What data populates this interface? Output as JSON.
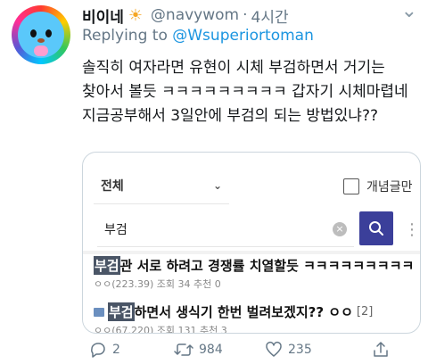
{
  "tweet": {
    "display_name": "비이네",
    "handle": "@navywom",
    "separator": "·",
    "time": "4시간",
    "reply_prefix": "Replying to",
    "reply_to": "@Wsuperiortoman",
    "text": "솔직히 여자라면 유현이 시체 부검하면서 거기는 찾아서 볼듯 ㅋㅋㅋㅋㅋㅋㅋㅋㅋ 갑자기 시체마렵네 지금공부해서 3일안에 부검의 되는 방법있냐??"
  },
  "icons": {
    "name_emoji": "sun-with-face-icon",
    "more": "chevron-down-icon"
  },
  "media": {
    "category_select": "전체",
    "checkbox_label": "개념글만",
    "search_value": "부검",
    "results": [
      {
        "highlight": "부검",
        "title_rest": "관 서로 하려고 경쟁률 치열할듯 ㅋㅋㅋㅋㅋㅋㅋㅋㅋ",
        "meta": "ㅇㅇ(223.39) 조회 34 추천 0"
      },
      {
        "highlight": "부검",
        "title_rest": "하면서 생식기 한번 벌려보겠지?? ㅇㅇ",
        "comments": "[2]",
        "meta": "ㅇㅇ(67.220) 조회 131 추천 3"
      }
    ],
    "colors": {
      "search_button": "#3b3f9a",
      "highlight": "#4a5566"
    }
  },
  "actions": {
    "reply_count": "2",
    "retweet_count": "984",
    "like_count": "235"
  },
  "colors": {
    "link": "#1b95e0",
    "muted": "#657786"
  }
}
